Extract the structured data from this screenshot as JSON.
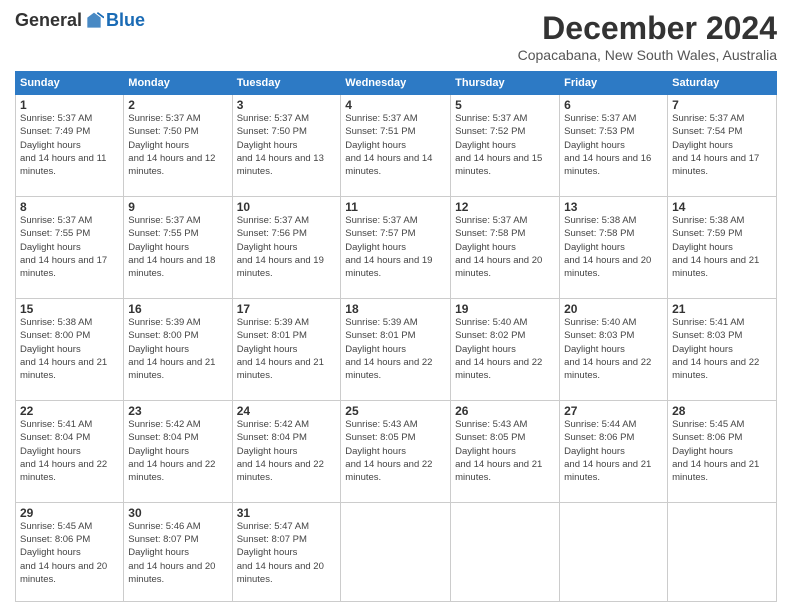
{
  "header": {
    "logo_general": "General",
    "logo_blue": "Blue",
    "month_title": "December 2024",
    "location": "Copacabana, New South Wales, Australia"
  },
  "weekdays": [
    "Sunday",
    "Monday",
    "Tuesday",
    "Wednesday",
    "Thursday",
    "Friday",
    "Saturday"
  ],
  "weeks": [
    [
      {
        "day": 1,
        "sunrise": "5:37 AM",
        "sunset": "7:49 PM",
        "daylight": "14 hours and 11 minutes."
      },
      {
        "day": 2,
        "sunrise": "5:37 AM",
        "sunset": "7:50 PM",
        "daylight": "14 hours and 12 minutes."
      },
      {
        "day": 3,
        "sunrise": "5:37 AM",
        "sunset": "7:50 PM",
        "daylight": "14 hours and 13 minutes."
      },
      {
        "day": 4,
        "sunrise": "5:37 AM",
        "sunset": "7:51 PM",
        "daylight": "14 hours and 14 minutes."
      },
      {
        "day": 5,
        "sunrise": "5:37 AM",
        "sunset": "7:52 PM",
        "daylight": "14 hours and 15 minutes."
      },
      {
        "day": 6,
        "sunrise": "5:37 AM",
        "sunset": "7:53 PM",
        "daylight": "14 hours and 16 minutes."
      },
      {
        "day": 7,
        "sunrise": "5:37 AM",
        "sunset": "7:54 PM",
        "daylight": "14 hours and 17 minutes."
      }
    ],
    [
      {
        "day": 8,
        "sunrise": "5:37 AM",
        "sunset": "7:55 PM",
        "daylight": "14 hours and 17 minutes."
      },
      {
        "day": 9,
        "sunrise": "5:37 AM",
        "sunset": "7:55 PM",
        "daylight": "14 hours and 18 minutes."
      },
      {
        "day": 10,
        "sunrise": "5:37 AM",
        "sunset": "7:56 PM",
        "daylight": "14 hours and 19 minutes."
      },
      {
        "day": 11,
        "sunrise": "5:37 AM",
        "sunset": "7:57 PM",
        "daylight": "14 hours and 19 minutes."
      },
      {
        "day": 12,
        "sunrise": "5:37 AM",
        "sunset": "7:58 PM",
        "daylight": "14 hours and 20 minutes."
      },
      {
        "day": 13,
        "sunrise": "5:38 AM",
        "sunset": "7:58 PM",
        "daylight": "14 hours and 20 minutes."
      },
      {
        "day": 14,
        "sunrise": "5:38 AM",
        "sunset": "7:59 PM",
        "daylight": "14 hours and 21 minutes."
      }
    ],
    [
      {
        "day": 15,
        "sunrise": "5:38 AM",
        "sunset": "8:00 PM",
        "daylight": "14 hours and 21 minutes."
      },
      {
        "day": 16,
        "sunrise": "5:39 AM",
        "sunset": "8:00 PM",
        "daylight": "14 hours and 21 minutes."
      },
      {
        "day": 17,
        "sunrise": "5:39 AM",
        "sunset": "8:01 PM",
        "daylight": "14 hours and 21 minutes."
      },
      {
        "day": 18,
        "sunrise": "5:39 AM",
        "sunset": "8:01 PM",
        "daylight": "14 hours and 22 minutes."
      },
      {
        "day": 19,
        "sunrise": "5:40 AM",
        "sunset": "8:02 PM",
        "daylight": "14 hours and 22 minutes."
      },
      {
        "day": 20,
        "sunrise": "5:40 AM",
        "sunset": "8:03 PM",
        "daylight": "14 hours and 22 minutes."
      },
      {
        "day": 21,
        "sunrise": "5:41 AM",
        "sunset": "8:03 PM",
        "daylight": "14 hours and 22 minutes."
      }
    ],
    [
      {
        "day": 22,
        "sunrise": "5:41 AM",
        "sunset": "8:04 PM",
        "daylight": "14 hours and 22 minutes."
      },
      {
        "day": 23,
        "sunrise": "5:42 AM",
        "sunset": "8:04 PM",
        "daylight": "14 hours and 22 minutes."
      },
      {
        "day": 24,
        "sunrise": "5:42 AM",
        "sunset": "8:04 PM",
        "daylight": "14 hours and 22 minutes."
      },
      {
        "day": 25,
        "sunrise": "5:43 AM",
        "sunset": "8:05 PM",
        "daylight": "14 hours and 22 minutes."
      },
      {
        "day": 26,
        "sunrise": "5:43 AM",
        "sunset": "8:05 PM",
        "daylight": "14 hours and 21 minutes."
      },
      {
        "day": 27,
        "sunrise": "5:44 AM",
        "sunset": "8:06 PM",
        "daylight": "14 hours and 21 minutes."
      },
      {
        "day": 28,
        "sunrise": "5:45 AM",
        "sunset": "8:06 PM",
        "daylight": "14 hours and 21 minutes."
      }
    ],
    [
      {
        "day": 29,
        "sunrise": "5:45 AM",
        "sunset": "8:06 PM",
        "daylight": "14 hours and 20 minutes."
      },
      {
        "day": 30,
        "sunrise": "5:46 AM",
        "sunset": "8:07 PM",
        "daylight": "14 hours and 20 minutes."
      },
      {
        "day": 31,
        "sunrise": "5:47 AM",
        "sunset": "8:07 PM",
        "daylight": "14 hours and 20 minutes."
      },
      null,
      null,
      null,
      null
    ]
  ]
}
